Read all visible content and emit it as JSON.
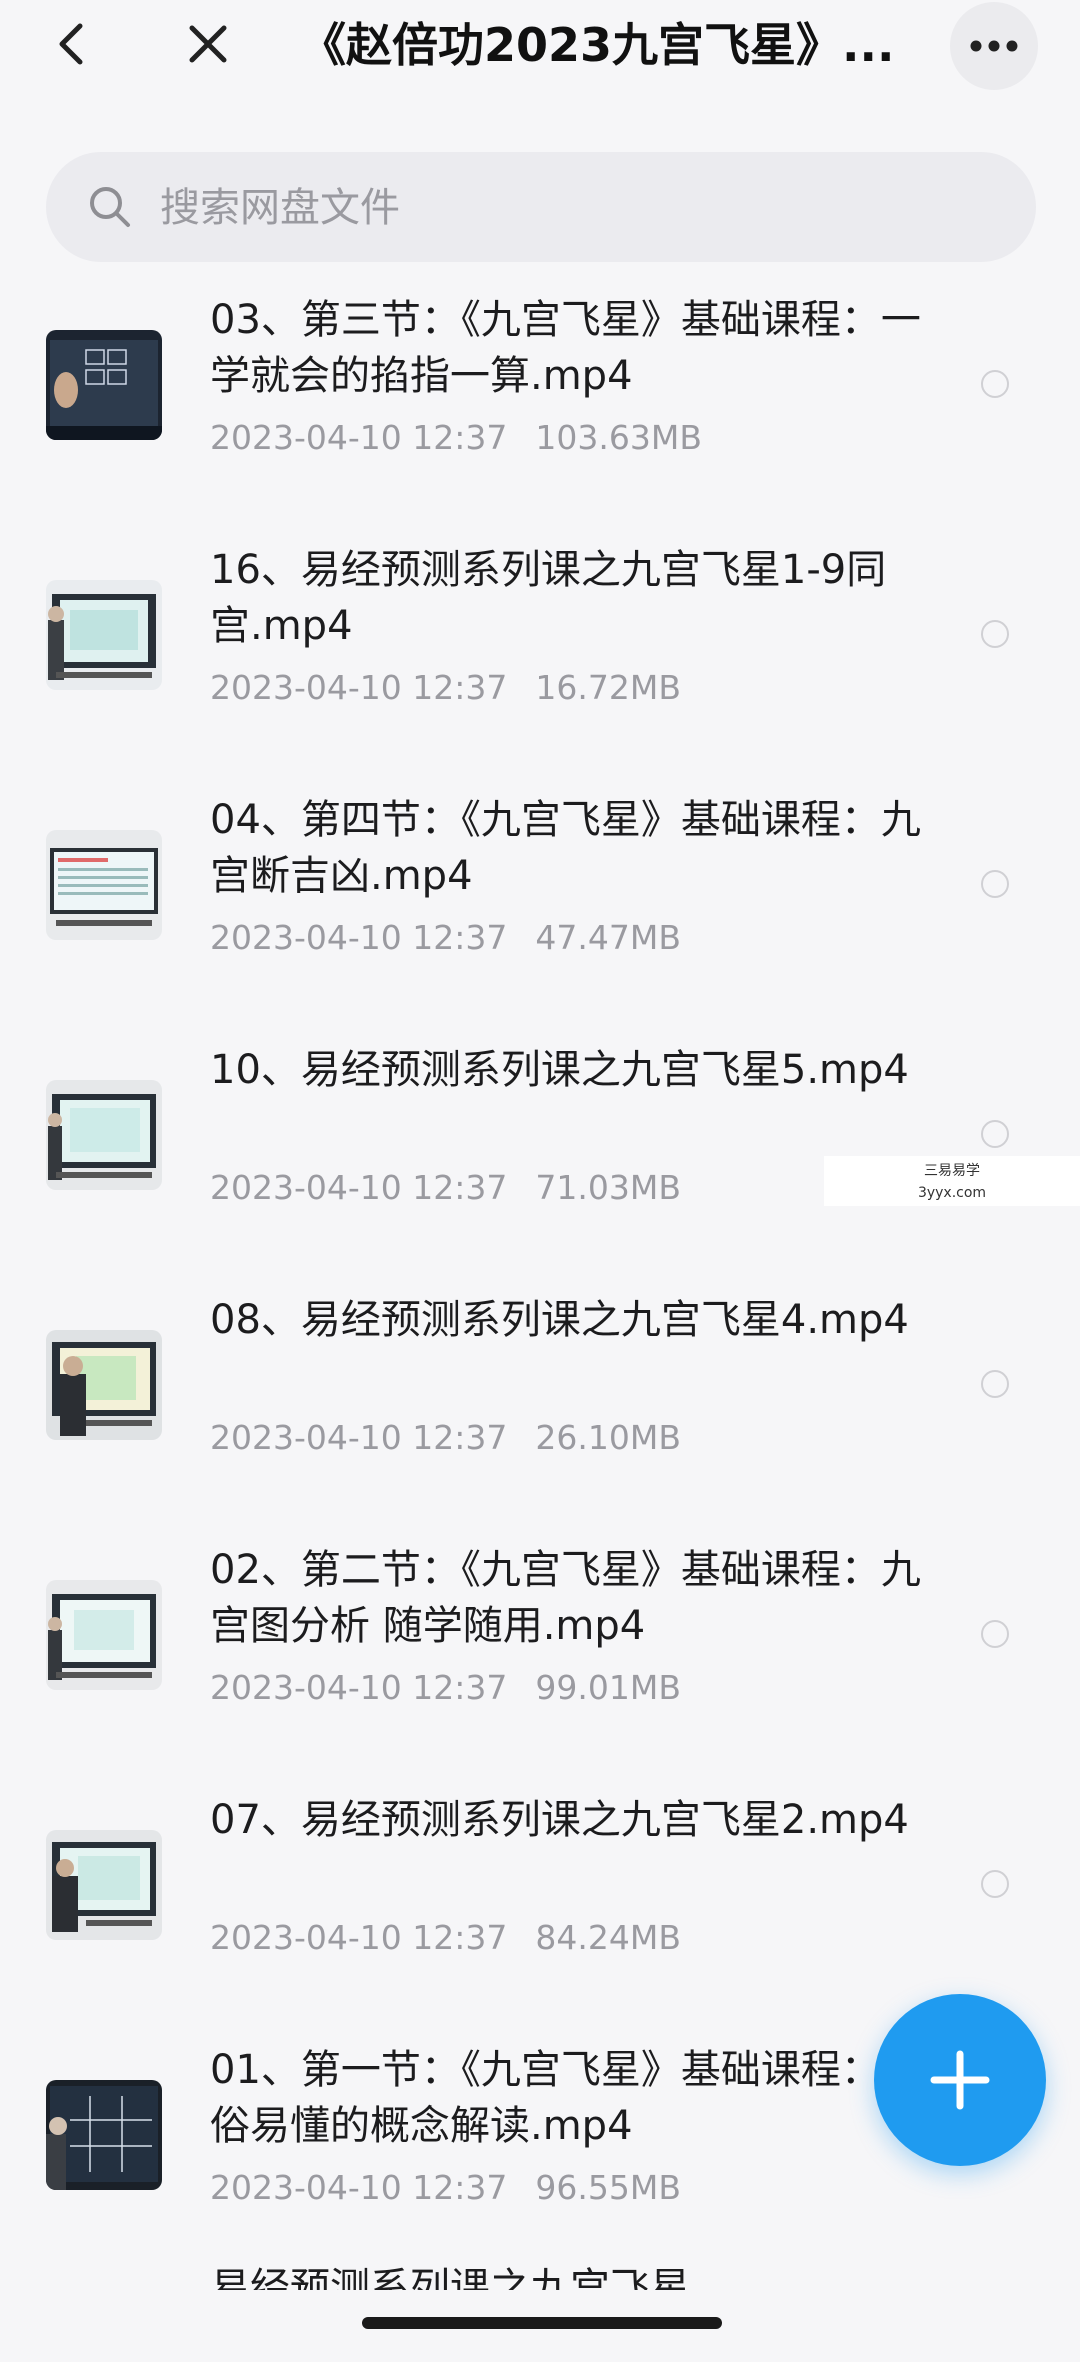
{
  "header": {
    "title": "《赵倍功2023九宫飞星》...",
    "back_icon": "chevron-left-icon",
    "close_icon": "close-icon",
    "more_icon": "more-horizontal-icon"
  },
  "search": {
    "placeholder": "搜索网盘文件",
    "icon": "search-icon"
  },
  "files": [
    {
      "name": "03、第三节：《九宫飞星》基础课程：一学就会的掐指一算.mp4",
      "date": "2023-04-10 12:37",
      "size": "103.63MB"
    },
    {
      "name": "16、易经预测系列课之九宫飞星1-9同宫.mp4",
      "date": "2023-04-10 12:37",
      "size": "16.72MB"
    },
    {
      "name": "04、第四节：《九宫飞星》基础课程：九宫断吉凶.mp4",
      "date": "2023-04-10 12:37",
      "size": "47.47MB"
    },
    {
      "name": "10、易经预测系列课之九宫飞星5.mp4",
      "date": "2023-04-10 12:37",
      "size": "71.03MB"
    },
    {
      "name": "08、易经预测系列课之九宫飞星4.mp4",
      "date": "2023-04-10 12:37",
      "size": "26.10MB"
    },
    {
      "name": "02、第二节：《九宫飞星》基础课程：九宫图分析 随学随用.mp4",
      "date": "2023-04-10 12:37",
      "size": "99.01MB"
    },
    {
      "name": "07、易经预测系列课之九宫飞星2.mp4",
      "date": "2023-04-10 12:37",
      "size": "84.24MB"
    },
    {
      "name": "01、第一节：《九宫飞星》基础课程：通俗易懂的概念解读.mp4",
      "date": "2023-04-10 12:37",
      "size": "96.55MB"
    }
  ],
  "partial_item_text": "易经预测系列课之九宫飞星",
  "watermark": {
    "line1": "三易易学",
    "line2": "3yyx.com"
  },
  "fab_icon": "plus-icon",
  "colors": {
    "background": "#f6f6f8",
    "accent": "#1f9bf0",
    "meta_text": "#9a9aa0"
  }
}
